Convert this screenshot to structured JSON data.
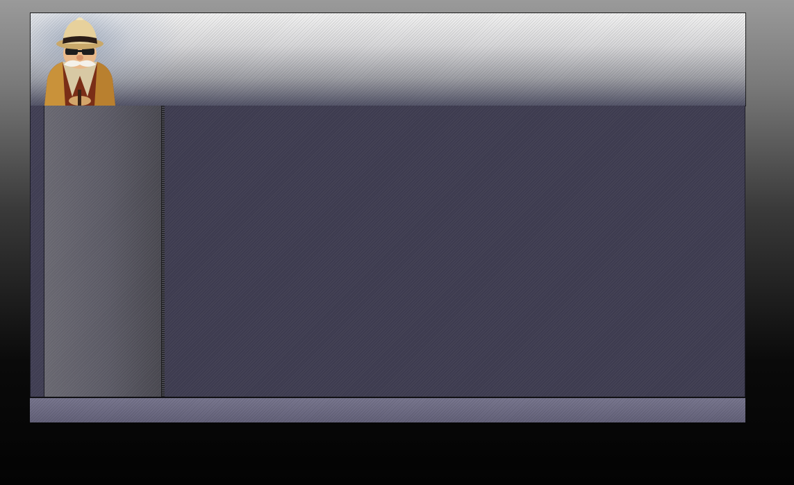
{
  "header": {
    "logo_icon": "detective-mascot-icon"
  },
  "sidebar": {
    "items": []
  },
  "main": {
    "content": ""
  },
  "footer": {
    "text": ""
  },
  "colors": {
    "background_top": "#9a9a9a",
    "background_bottom": "#030303",
    "header_light": "#f2f2f2",
    "header_dark": "#55566a",
    "sidebar": "#5a5964",
    "main": "#3d3b4f",
    "footer": "#6e6c85"
  }
}
